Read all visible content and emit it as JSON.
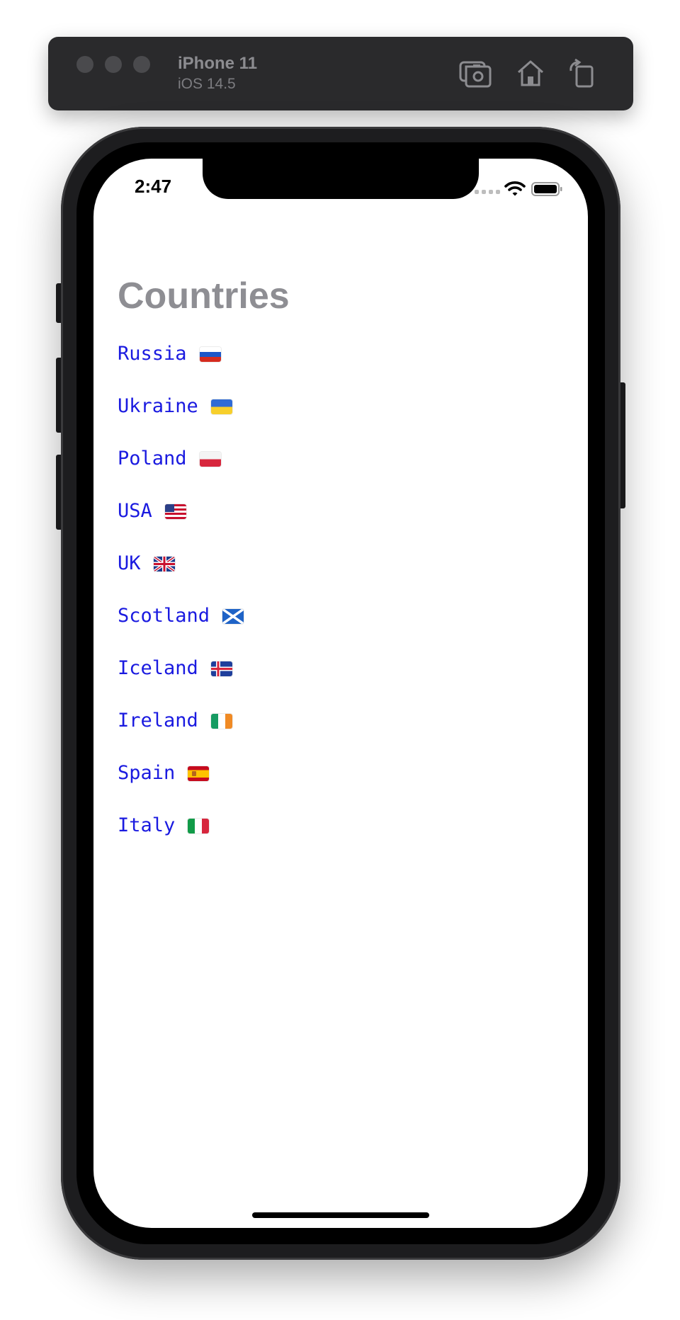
{
  "simulator": {
    "device_name": "iPhone 11",
    "os_version": "iOS 14.5",
    "toolbar_icons": [
      "screenshot-icon",
      "home-icon",
      "rotate-icon"
    ]
  },
  "status_bar": {
    "time": "2:47"
  },
  "page": {
    "title": "Countries",
    "title_color": "#8e8e93",
    "link_color": "#1a1ae0"
  },
  "countries": [
    {
      "name": "Russia",
      "flag_icon": "russia-flag-icon"
    },
    {
      "name": "Ukraine",
      "flag_icon": "ukraine-flag-icon"
    },
    {
      "name": "Poland",
      "flag_icon": "poland-flag-icon"
    },
    {
      "name": "USA",
      "flag_icon": "usa-flag-icon"
    },
    {
      "name": "UK",
      "flag_icon": "uk-flag-icon"
    },
    {
      "name": "Scotland",
      "flag_icon": "scotland-flag-icon"
    },
    {
      "name": "Iceland",
      "flag_icon": "iceland-flag-icon"
    },
    {
      "name": "Ireland",
      "flag_icon": "ireland-flag-icon"
    },
    {
      "name": "Spain",
      "flag_icon": "spain-flag-icon"
    },
    {
      "name": "Italy",
      "flag_icon": "italy-flag-icon"
    }
  ]
}
